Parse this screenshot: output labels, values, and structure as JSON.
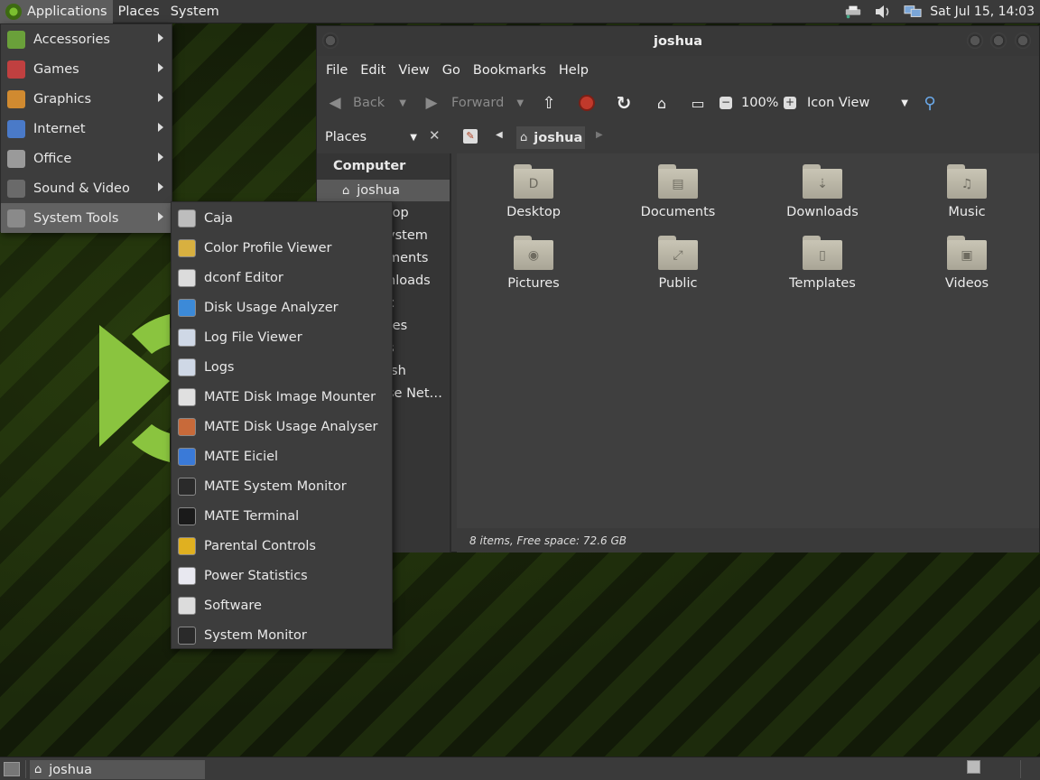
{
  "top_panel": {
    "menus": [
      "Applications",
      "Places",
      "System"
    ],
    "clock": "Sat Jul 15, 14:03"
  },
  "applications_menu": [
    {
      "label": "Accessories",
      "icon": "accessories-icon",
      "color": "#6aa03a"
    },
    {
      "label": "Games",
      "icon": "games-icon",
      "color": "#c04040"
    },
    {
      "label": "Graphics",
      "icon": "graphics-icon",
      "color": "#d08a30"
    },
    {
      "label": "Internet",
      "icon": "internet-icon",
      "color": "#4a7ac8"
    },
    {
      "label": "Office",
      "icon": "office-icon",
      "color": "#9a9a9a"
    },
    {
      "label": "Sound & Video",
      "icon": "sound-video-icon",
      "color": "#6a6a6a"
    },
    {
      "label": "System Tools",
      "icon": "gear-icon",
      "color": "#8a8a8a"
    }
  ],
  "system_tools_menu": [
    {
      "label": "Caja",
      "icon": "caja-icon",
      "color": "#bdbdbd"
    },
    {
      "label": "Color Profile Viewer",
      "icon": "color-profile-icon",
      "color": "#d8b040"
    },
    {
      "label": "dconf Editor",
      "icon": "dconf-icon",
      "color": "#dcdcdc"
    },
    {
      "label": "Disk Usage Analyzer",
      "icon": "pie-chart-icon",
      "color": "#3c8ad8"
    },
    {
      "label": "Log File Viewer",
      "icon": "magnifier-icon",
      "color": "#cfd8e6"
    },
    {
      "label": "Logs",
      "icon": "magnifier-icon",
      "color": "#cfd8e6"
    },
    {
      "label": "MATE Disk Image Mounter",
      "icon": "disk-mounter-icon",
      "color": "#e0e0e0"
    },
    {
      "label": "MATE Disk Usage Analyser",
      "icon": "disk-analyser-icon",
      "color": "#c86a3a"
    },
    {
      "label": "MATE Eiciel",
      "icon": "eiciel-icon",
      "color": "#3a7ad8"
    },
    {
      "label": "MATE System Monitor",
      "icon": "system-monitor-icon",
      "color": "#2a2a2a"
    },
    {
      "label": "MATE Terminal",
      "icon": "terminal-icon",
      "color": "#1a1a1a"
    },
    {
      "label": "Parental Controls",
      "icon": "parental-controls-icon",
      "color": "#e0b020"
    },
    {
      "label": "Power Statistics",
      "icon": "power-statistics-icon",
      "color": "#e8e8f0"
    },
    {
      "label": "Software",
      "icon": "software-icon",
      "color": "#dcdcdc"
    },
    {
      "label": "System Monitor",
      "icon": "system-monitor-icon",
      "color": "#2a2a2a"
    }
  ],
  "caja": {
    "title": "joshua",
    "menubar": [
      "File",
      "Edit",
      "View",
      "Go",
      "Bookmarks",
      "Help"
    ],
    "toolbar": {
      "back": "Back",
      "forward": "Forward",
      "zoom": "100%",
      "view_mode": "Icon View"
    },
    "places_combo": "Places",
    "path_button": "joshua",
    "sidebar": {
      "heading": "Computer",
      "items": [
        "joshua",
        "top",
        "ystem",
        "ments",
        "nloads",
        "c",
        "res",
        "s",
        "ish",
        "se Net…"
      ]
    },
    "files": [
      {
        "label": "Desktop",
        "icon": "desktop-folder-icon",
        "glyph": "D"
      },
      {
        "label": "Documents",
        "icon": "documents-folder-icon",
        "glyph": "▤"
      },
      {
        "label": "Downloads",
        "icon": "downloads-folder-icon",
        "glyph": "⇣"
      },
      {
        "label": "Music",
        "icon": "music-folder-icon",
        "glyph": "♫"
      },
      {
        "label": "Pictures",
        "icon": "pictures-folder-icon",
        "glyph": "◉"
      },
      {
        "label": "Public",
        "icon": "public-folder-icon",
        "glyph": "⤢"
      },
      {
        "label": "Templates",
        "icon": "templates-folder-icon",
        "glyph": "▯"
      },
      {
        "label": "Videos",
        "icon": "videos-folder-icon",
        "glyph": "▣"
      }
    ],
    "status": "8 items, Free space: 72.6 GB"
  },
  "bottom_panel": {
    "task": "joshua"
  }
}
